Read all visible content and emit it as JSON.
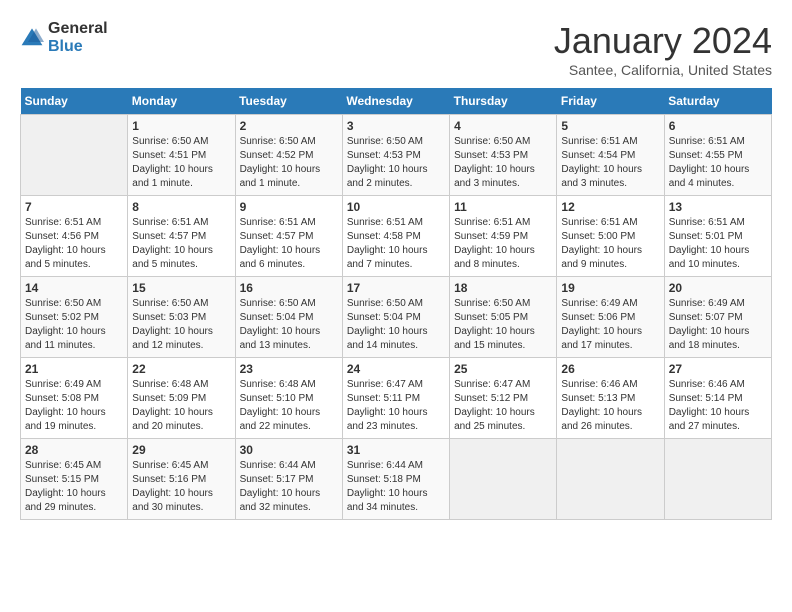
{
  "header": {
    "logo_line1": "General",
    "logo_line2": "Blue",
    "month_title": "January 2024",
    "location": "Santee, California, United States"
  },
  "columns": [
    "Sunday",
    "Monday",
    "Tuesday",
    "Wednesday",
    "Thursday",
    "Friday",
    "Saturday"
  ],
  "weeks": [
    [
      {
        "day": "",
        "detail": ""
      },
      {
        "day": "1",
        "detail": "Sunrise: 6:50 AM\nSunset: 4:51 PM\nDaylight: 10 hours\nand 1 minute."
      },
      {
        "day": "2",
        "detail": "Sunrise: 6:50 AM\nSunset: 4:52 PM\nDaylight: 10 hours\nand 1 minute."
      },
      {
        "day": "3",
        "detail": "Sunrise: 6:50 AM\nSunset: 4:53 PM\nDaylight: 10 hours\nand 2 minutes."
      },
      {
        "day": "4",
        "detail": "Sunrise: 6:50 AM\nSunset: 4:53 PM\nDaylight: 10 hours\nand 3 minutes."
      },
      {
        "day": "5",
        "detail": "Sunrise: 6:51 AM\nSunset: 4:54 PM\nDaylight: 10 hours\nand 3 minutes."
      },
      {
        "day": "6",
        "detail": "Sunrise: 6:51 AM\nSunset: 4:55 PM\nDaylight: 10 hours\nand 4 minutes."
      }
    ],
    [
      {
        "day": "7",
        "detail": "Sunrise: 6:51 AM\nSunset: 4:56 PM\nDaylight: 10 hours\nand 5 minutes."
      },
      {
        "day": "8",
        "detail": "Sunrise: 6:51 AM\nSunset: 4:57 PM\nDaylight: 10 hours\nand 5 minutes."
      },
      {
        "day": "9",
        "detail": "Sunrise: 6:51 AM\nSunset: 4:57 PM\nDaylight: 10 hours\nand 6 minutes."
      },
      {
        "day": "10",
        "detail": "Sunrise: 6:51 AM\nSunset: 4:58 PM\nDaylight: 10 hours\nand 7 minutes."
      },
      {
        "day": "11",
        "detail": "Sunrise: 6:51 AM\nSunset: 4:59 PM\nDaylight: 10 hours\nand 8 minutes."
      },
      {
        "day": "12",
        "detail": "Sunrise: 6:51 AM\nSunset: 5:00 PM\nDaylight: 10 hours\nand 9 minutes."
      },
      {
        "day": "13",
        "detail": "Sunrise: 6:51 AM\nSunset: 5:01 PM\nDaylight: 10 hours\nand 10 minutes."
      }
    ],
    [
      {
        "day": "14",
        "detail": "Sunrise: 6:50 AM\nSunset: 5:02 PM\nDaylight: 10 hours\nand 11 minutes."
      },
      {
        "day": "15",
        "detail": "Sunrise: 6:50 AM\nSunset: 5:03 PM\nDaylight: 10 hours\nand 12 minutes."
      },
      {
        "day": "16",
        "detail": "Sunrise: 6:50 AM\nSunset: 5:04 PM\nDaylight: 10 hours\nand 13 minutes."
      },
      {
        "day": "17",
        "detail": "Sunrise: 6:50 AM\nSunset: 5:04 PM\nDaylight: 10 hours\nand 14 minutes."
      },
      {
        "day": "18",
        "detail": "Sunrise: 6:50 AM\nSunset: 5:05 PM\nDaylight: 10 hours\nand 15 minutes."
      },
      {
        "day": "19",
        "detail": "Sunrise: 6:49 AM\nSunset: 5:06 PM\nDaylight: 10 hours\nand 17 minutes."
      },
      {
        "day": "20",
        "detail": "Sunrise: 6:49 AM\nSunset: 5:07 PM\nDaylight: 10 hours\nand 18 minutes."
      }
    ],
    [
      {
        "day": "21",
        "detail": "Sunrise: 6:49 AM\nSunset: 5:08 PM\nDaylight: 10 hours\nand 19 minutes."
      },
      {
        "day": "22",
        "detail": "Sunrise: 6:48 AM\nSunset: 5:09 PM\nDaylight: 10 hours\nand 20 minutes."
      },
      {
        "day": "23",
        "detail": "Sunrise: 6:48 AM\nSunset: 5:10 PM\nDaylight: 10 hours\nand 22 minutes."
      },
      {
        "day": "24",
        "detail": "Sunrise: 6:47 AM\nSunset: 5:11 PM\nDaylight: 10 hours\nand 23 minutes."
      },
      {
        "day": "25",
        "detail": "Sunrise: 6:47 AM\nSunset: 5:12 PM\nDaylight: 10 hours\nand 25 minutes."
      },
      {
        "day": "26",
        "detail": "Sunrise: 6:46 AM\nSunset: 5:13 PM\nDaylight: 10 hours\nand 26 minutes."
      },
      {
        "day": "27",
        "detail": "Sunrise: 6:46 AM\nSunset: 5:14 PM\nDaylight: 10 hours\nand 27 minutes."
      }
    ],
    [
      {
        "day": "28",
        "detail": "Sunrise: 6:45 AM\nSunset: 5:15 PM\nDaylight: 10 hours\nand 29 minutes."
      },
      {
        "day": "29",
        "detail": "Sunrise: 6:45 AM\nSunset: 5:16 PM\nDaylight: 10 hours\nand 30 minutes."
      },
      {
        "day": "30",
        "detail": "Sunrise: 6:44 AM\nSunset: 5:17 PM\nDaylight: 10 hours\nand 32 minutes."
      },
      {
        "day": "31",
        "detail": "Sunrise: 6:44 AM\nSunset: 5:18 PM\nDaylight: 10 hours\nand 34 minutes."
      },
      {
        "day": "",
        "detail": ""
      },
      {
        "day": "",
        "detail": ""
      },
      {
        "day": "",
        "detail": ""
      }
    ]
  ]
}
